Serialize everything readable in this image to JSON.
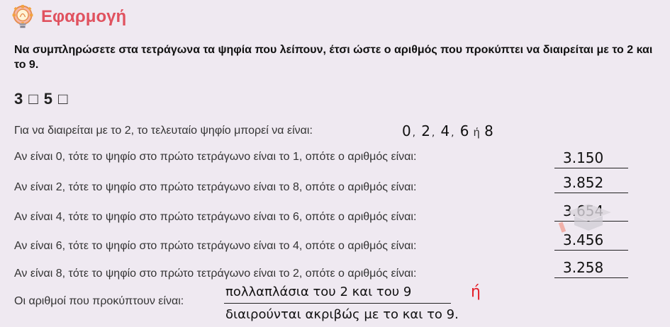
{
  "header": {
    "title": "Εφαρμογή",
    "icon": "lightbulb-gear-icon"
  },
  "instruction": "Να συμπληρώσετε στα τετράγωνα τα ψηφία που λείπουν, έτσι ώστε ο αριθμός που προκύπτει να διαιρείται με το 2 και το 9.",
  "number": "3 □ 5 □",
  "rule": {
    "text": "Για να διαιρείται με το 2, το τελευταίο ψηφίο μπορεί να είναι:",
    "digits": [
      "0",
      "2",
      "4",
      "6",
      "8"
    ],
    "separator": ",",
    "or_word": "ή"
  },
  "rows": [
    {
      "text": "Αν είναι 0, τότε το ψηφίο στο πρώτο τετράγωνο είναι το 1, οπότε ο αριθμός είναι:",
      "answer": "3.150"
    },
    {
      "text": "Αν είναι 2, τότε το ψηφίο στο πρώτο τετράγωνο είναι το 8, οπότε ο αριθμός είναι:",
      "answer": "3.852"
    },
    {
      "text": "Αν είναι 4, τότε το ψηφίο στο πρώτο τετράγωνο είναι το 6, οπότε ο αριθμός είναι:",
      "answer": "3.654"
    },
    {
      "text": "Αν είναι 6, τότε το ψηφίο στο πρώτο τετράγωνο είναι το 4, οπότε ο αριθμός είναι:",
      "answer": "3.456"
    },
    {
      "text": "Αν είναι 8, τότε το ψηφίο στο πρώτο τετράγωνο είναι το 2, οπότε ο αριθμός είναι:",
      "answer": "3.258"
    }
  ],
  "conclusion": {
    "text": "Οι αριθμοί που προκύπτουν είναι:",
    "answer_line1": "πολλαπλάσια του 2 και του 9",
    "or_word": "ή",
    "answer_line2": "διαιρούνται ακριβώς με το και το 9."
  },
  "colors": {
    "accent": "#e0525f",
    "background": "#efe9f1",
    "handwriting_or": "#e4202a"
  }
}
